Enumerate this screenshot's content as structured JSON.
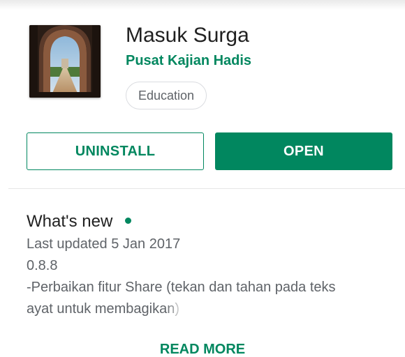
{
  "app": {
    "title": "Masuk Surga",
    "developer": "Pusat Kajian Hadis",
    "category": "Education"
  },
  "actions": {
    "uninstall_label": "UNINSTALL",
    "open_label": "OPEN"
  },
  "whats_new": {
    "title": "What's new",
    "last_updated": "Last updated 5 Jan 2017",
    "version": "0.8.8",
    "notes_line1": "-Perbaikan fitur Share (tekan dan tahan pada teks",
    "notes_line2_visible": "ayat untuk membagik",
    "notes_line2_faded": "an)",
    "read_more_label": "READ MORE"
  },
  "colors": {
    "accent": "#01875f",
    "title_text": "#212121",
    "body_text": "#5f6368"
  },
  "icons": {
    "app_icon": "app-icon-archway",
    "new_indicator": "new-dot-icon"
  }
}
